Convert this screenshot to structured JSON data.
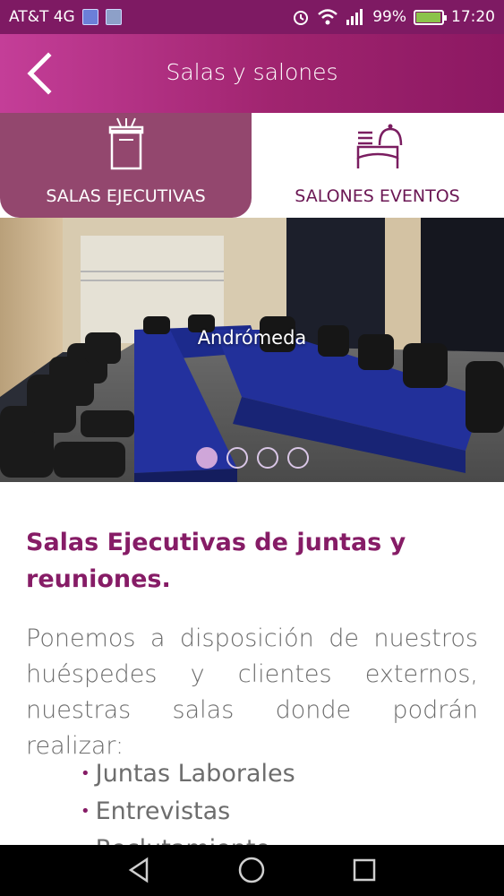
{
  "status_bar": {
    "carrier": "AT&T 4G",
    "battery_percent": "99%",
    "time": "17:20",
    "icons": [
      "usb-icon",
      "image-icon",
      "alarm-icon",
      "wifi-icon",
      "signal-icon",
      "battery-icon"
    ]
  },
  "header": {
    "title": "Salas y salones",
    "back_icon": "chevron-left-icon"
  },
  "tabs": [
    {
      "label": "SALAS EJECUTIVAS",
      "icon": "podium-icon",
      "active": true
    },
    {
      "label": "SALONES EVENTOS",
      "icon": "banquet-table-icon",
      "active": false
    }
  ],
  "carousel": {
    "caption": "Andrómeda",
    "slide_count": 4,
    "active_index": 0
  },
  "content": {
    "title_line1": "Salas Ejecutivas de juntas y",
    "title_line2": "reuniones.",
    "body": "Ponemos a disposición de nuestros huéspedes y clientes externos, nuestras salas donde podrán realizar:",
    "bullets": [
      "Juntas Laborales",
      "Entrevistas",
      "Reclutamiento"
    ]
  },
  "colors": {
    "brand": "#861c66",
    "header_start": "#c43e98",
    "header_end": "#8c1862",
    "tab_active": "#93476e"
  },
  "nav_bar": [
    "back-triangle-icon",
    "home-circle-icon",
    "recents-square-icon"
  ]
}
